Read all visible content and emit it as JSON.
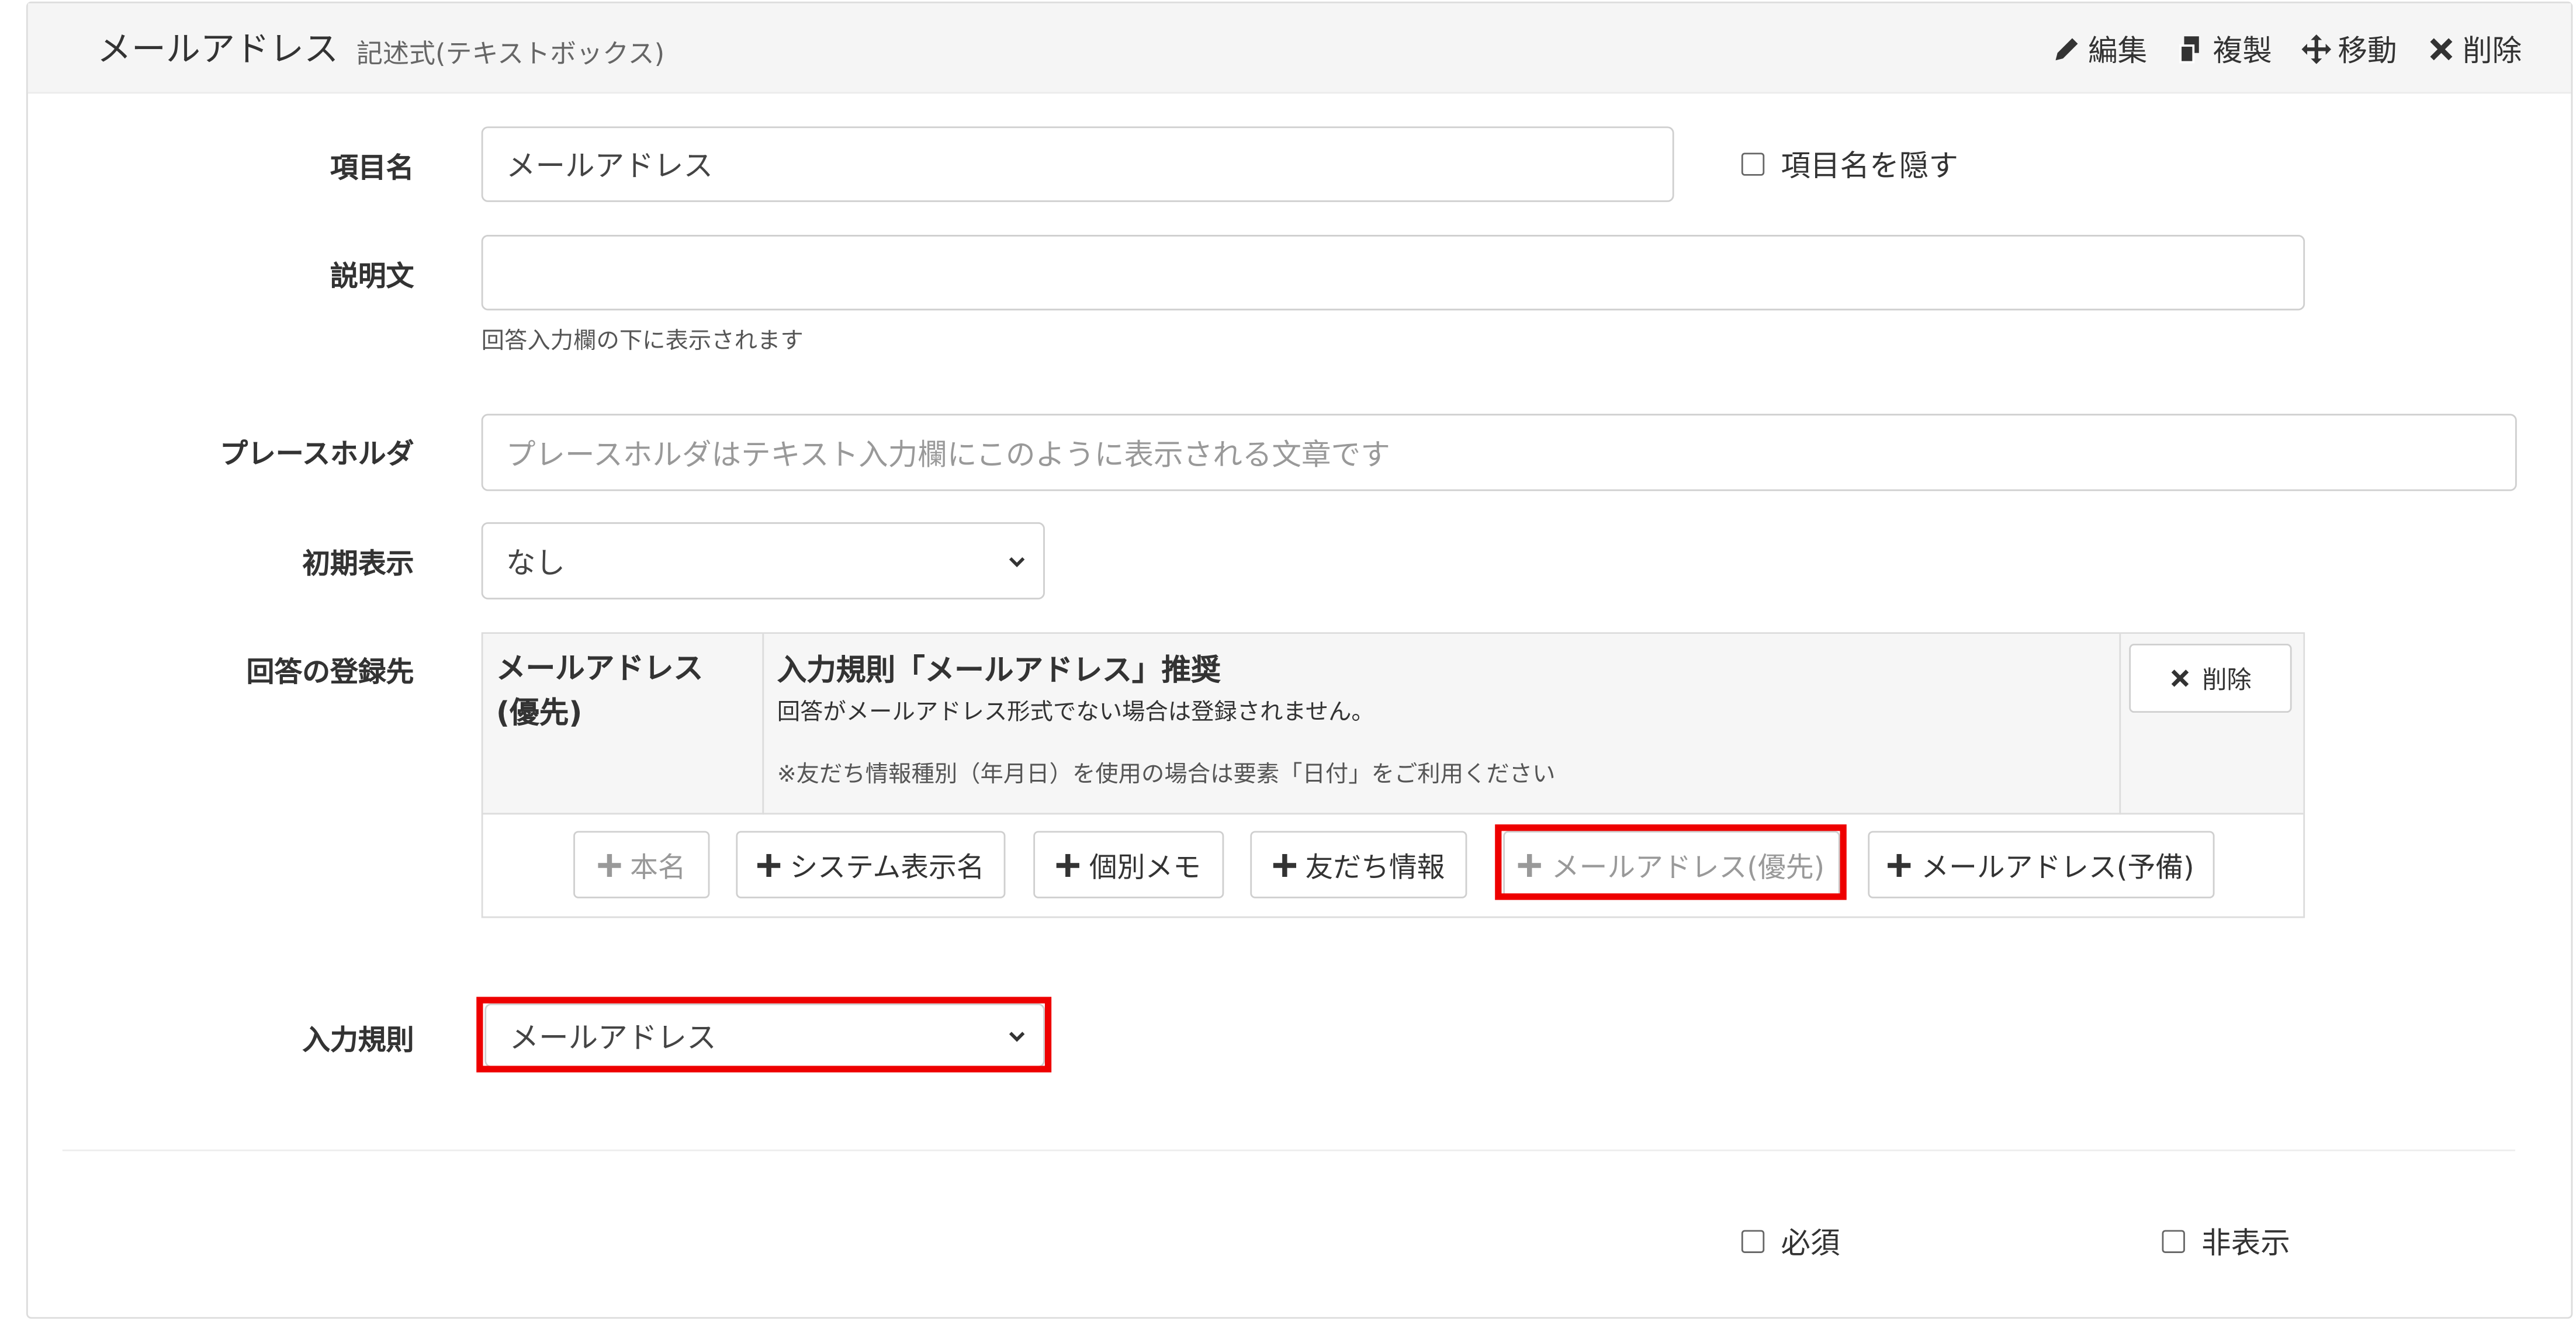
{
  "header": {
    "title": "メールアドレス",
    "subtitle": "記述式(テキストボックス)",
    "actions": {
      "edit": "編集",
      "duplicate": "複製",
      "move": "移動",
      "delete": "削除"
    }
  },
  "form": {
    "item_name": {
      "label": "項目名",
      "value": "メールアドレス",
      "hide_label": "項目名を隠す"
    },
    "description": {
      "label": "説明文",
      "value": "",
      "hint": "回答入力欄の下に表示されます"
    },
    "placeholder": {
      "label": "プレースホルダ",
      "value": "",
      "placeholder_text": "プレースホルダはテキスト入力欄にこのように表示される文章です"
    },
    "initial_display": {
      "label": "初期表示",
      "value": "なし"
    },
    "destination": {
      "label": "回答の登録先",
      "row": {
        "field_line1": "メールアドレス",
        "field_line2": "(優先)",
        "rule_title": "入力規則「メールアドレス」推奨",
        "rule_desc": "回答がメールアドレス形式でない場合は登録されません。",
        "rule_note": "※友だち情報種別（年月日）を使用の場合は要素「日付」をご利用ください",
        "delete_label": "削除"
      },
      "buttons": {
        "real_name": "本名",
        "system_display_name": "システム表示名",
        "personal_memo": "個別メモ",
        "friend_info": "友だち情報",
        "email_primary": "メールアドレス(優先)",
        "email_backup": "メールアドレス(予備)"
      }
    },
    "input_rule": {
      "label": "入力規則",
      "value": "メールアドレス"
    }
  },
  "footer": {
    "required": "必須",
    "hidden": "非表示"
  },
  "colors": {
    "highlight": "#ee0000",
    "header_bg": "#f5f5f5",
    "border": "#dcdcdc"
  }
}
